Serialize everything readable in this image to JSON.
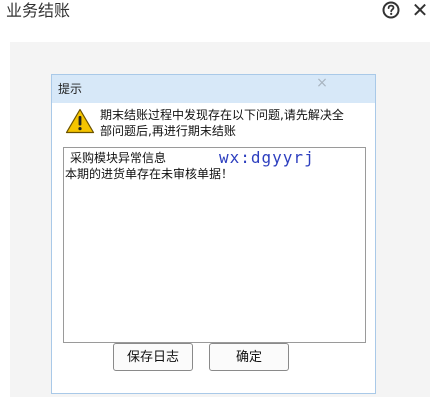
{
  "window": {
    "title": "业务结账",
    "help_icon": "question-circle-icon",
    "close_icon": "close-x-icon"
  },
  "dialog": {
    "title": "提示",
    "close_symbol": "×",
    "warning_icon": "warning-triangle-icon",
    "message_line1": "期末结账过程中发现存在以下问题,请先解决全",
    "message_line2": "部问题后,再进行期末结账",
    "log": {
      "heading": "采购模块异常信息",
      "line": "本期的进货单存在未审核单据！"
    },
    "watermark": "wx:dgyyrj",
    "buttons": {
      "save_log": "保存日志",
      "ok": "确定"
    }
  },
  "colors": {
    "dialog_header": "#d7e8f8",
    "dialog_border": "#a9c9e8",
    "watermark": "#2d3fbf",
    "warning_fill": "#f5c400"
  }
}
